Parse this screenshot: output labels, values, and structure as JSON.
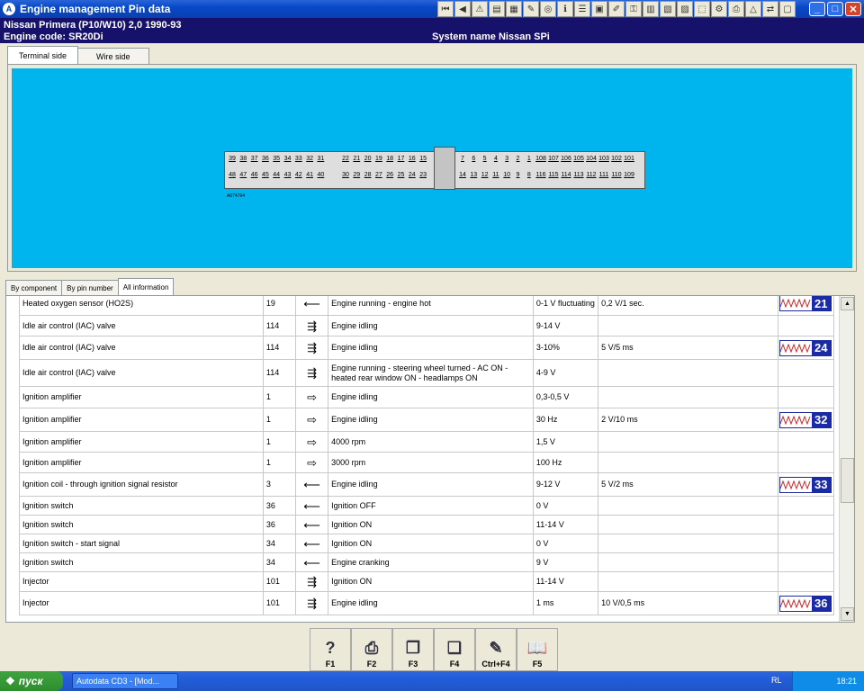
{
  "window": {
    "title": "Engine management Pin data",
    "buttons": {
      "minimize": "_",
      "maximize": "□",
      "close": "✕"
    },
    "toolbar_icons": [
      "first-icon",
      "prev-icon",
      "warning-icon",
      "page-icon",
      "chart-icon",
      "tool-icon",
      "globe-icon",
      "info-icon",
      "list-icon",
      "book-icon",
      "pen-icon",
      "key-icon",
      "folder-icon",
      "camera-icon",
      "save-icon",
      "car-icon",
      "gear-icon",
      "print-icon",
      "alert-icon",
      "link-icon",
      "note-icon"
    ]
  },
  "vehicle": {
    "line1": "Nissan   Primera (P10/W10) 2,0  1990-93",
    "line2": "Engine code: SR20Di",
    "system": "System name Nissan SPi"
  },
  "top_tabs": [
    {
      "label": "Terminal side",
      "active": true
    },
    {
      "label": "Wire side",
      "active": false
    }
  ],
  "connector": {
    "code": "A074764",
    "row1": [
      "39",
      "38",
      "37",
      "36",
      "35",
      "34",
      "33",
      "32",
      "31",
      "22",
      "21",
      "20",
      "19",
      "18",
      "17",
      "16",
      "15",
      "7",
      "6",
      "5",
      "4",
      "3",
      "2",
      "1",
      "108",
      "107",
      "106",
      "105",
      "104",
      "103",
      "102",
      "101"
    ],
    "row2": [
      "48",
      "47",
      "46",
      "45",
      "44",
      "43",
      "42",
      "41",
      "40",
      "30",
      "29",
      "28",
      "27",
      "26",
      "25",
      "24",
      "23",
      "14",
      "13",
      "12",
      "11",
      "10",
      "9",
      "8",
      "116",
      "115",
      "114",
      "113",
      "112",
      "111",
      "110",
      "109"
    ]
  },
  "bottom_tabs": [
    {
      "label": "By component",
      "active": false
    },
    {
      "label": "By pin number",
      "active": false
    },
    {
      "label": "All information",
      "active": true
    }
  ],
  "rows": [
    {
      "component": "Heated oxygen sensor (HO2S)",
      "pin": "19",
      "symbol": "⟵",
      "condition": "Engine running - engine hot",
      "value": "0-1 V fluctuating",
      "signal": "0,2 V/1 sec.",
      "scope": "21"
    },
    {
      "component": "Idle air control (IAC) valve",
      "pin": "114",
      "symbol": "⇶",
      "condition": "Engine idling",
      "value": "9-14 V",
      "signal": "",
      "scope": ""
    },
    {
      "component": "Idle air control (IAC) valve",
      "pin": "114",
      "symbol": "⇶",
      "condition": "Engine idling",
      "value": "3-10%",
      "signal": "5 V/5 ms",
      "scope": "24"
    },
    {
      "component": "Idle air control (IAC) valve",
      "pin": "114",
      "symbol": "⇶",
      "condition": "Engine running - steering wheel turned - AC ON - heated rear window ON - headlamps ON",
      "value": "4-9 V",
      "signal": "",
      "scope": ""
    },
    {
      "component": "Ignition amplifier",
      "pin": "1",
      "symbol": "⇨",
      "condition": "Engine idling",
      "value": "0,3-0,5 V",
      "signal": "",
      "scope": ""
    },
    {
      "component": "Ignition amplifier",
      "pin": "1",
      "symbol": "⇨",
      "condition": "Engine idling",
      "value": "30 Hz",
      "signal": "2 V/10 ms",
      "scope": "32"
    },
    {
      "component": "Ignition amplifier",
      "pin": "1",
      "symbol": "⇨",
      "condition": "4000 rpm",
      "value": "1,5 V",
      "signal": "",
      "scope": ""
    },
    {
      "component": "Ignition amplifier",
      "pin": "1",
      "symbol": "⇨",
      "condition": "3000 rpm",
      "value": "100 Hz",
      "signal": "",
      "scope": ""
    },
    {
      "component": "Ignition coil - through ignition signal resistor",
      "pin": "3",
      "symbol": "⟵",
      "condition": "Engine idling",
      "value": "9-12 V",
      "signal": "5 V/2 ms",
      "scope": "33"
    },
    {
      "component": "Ignition switch",
      "pin": "36",
      "symbol": "⟵",
      "condition": "Ignition OFF",
      "value": "0 V",
      "signal": "",
      "scope": ""
    },
    {
      "component": "Ignition switch",
      "pin": "36",
      "symbol": "⟵",
      "condition": "Ignition ON",
      "value": "11-14 V",
      "signal": "",
      "scope": ""
    },
    {
      "component": "Ignition switch - start signal",
      "pin": "34",
      "symbol": "⟵",
      "condition": "Ignition ON",
      "value": "0 V",
      "signal": "",
      "scope": ""
    },
    {
      "component": "Ignition switch",
      "pin": "34",
      "symbol": "⟵",
      "condition": "Engine cranking",
      "value": "9 V",
      "signal": "",
      "scope": ""
    },
    {
      "component": "Injector",
      "pin": "101",
      "symbol": "⇶",
      "condition": "Ignition ON",
      "value": "11-14 V",
      "signal": "",
      "scope": ""
    },
    {
      "component": "Injector",
      "pin": "101",
      "symbol": "⇶",
      "condition": "Engine idling",
      "value": "1 ms",
      "signal": "10 V/0,5 ms",
      "scope": "36"
    }
  ],
  "fkeys": [
    {
      "label": "F1",
      "icon": "help-icon"
    },
    {
      "label": "F2",
      "icon": "print-icon"
    },
    {
      "label": "F3",
      "icon": "copy-icon"
    },
    {
      "label": "F4",
      "icon": "copy-all-icon"
    },
    {
      "label": "Ctrl+F4",
      "icon": "notes-icon"
    },
    {
      "label": "F5",
      "icon": "book-icon"
    }
  ],
  "taskbar": {
    "start": "пуск",
    "task": "Autodata CD3 - [Mod...",
    "lang": "RL",
    "clock": "18:21"
  }
}
